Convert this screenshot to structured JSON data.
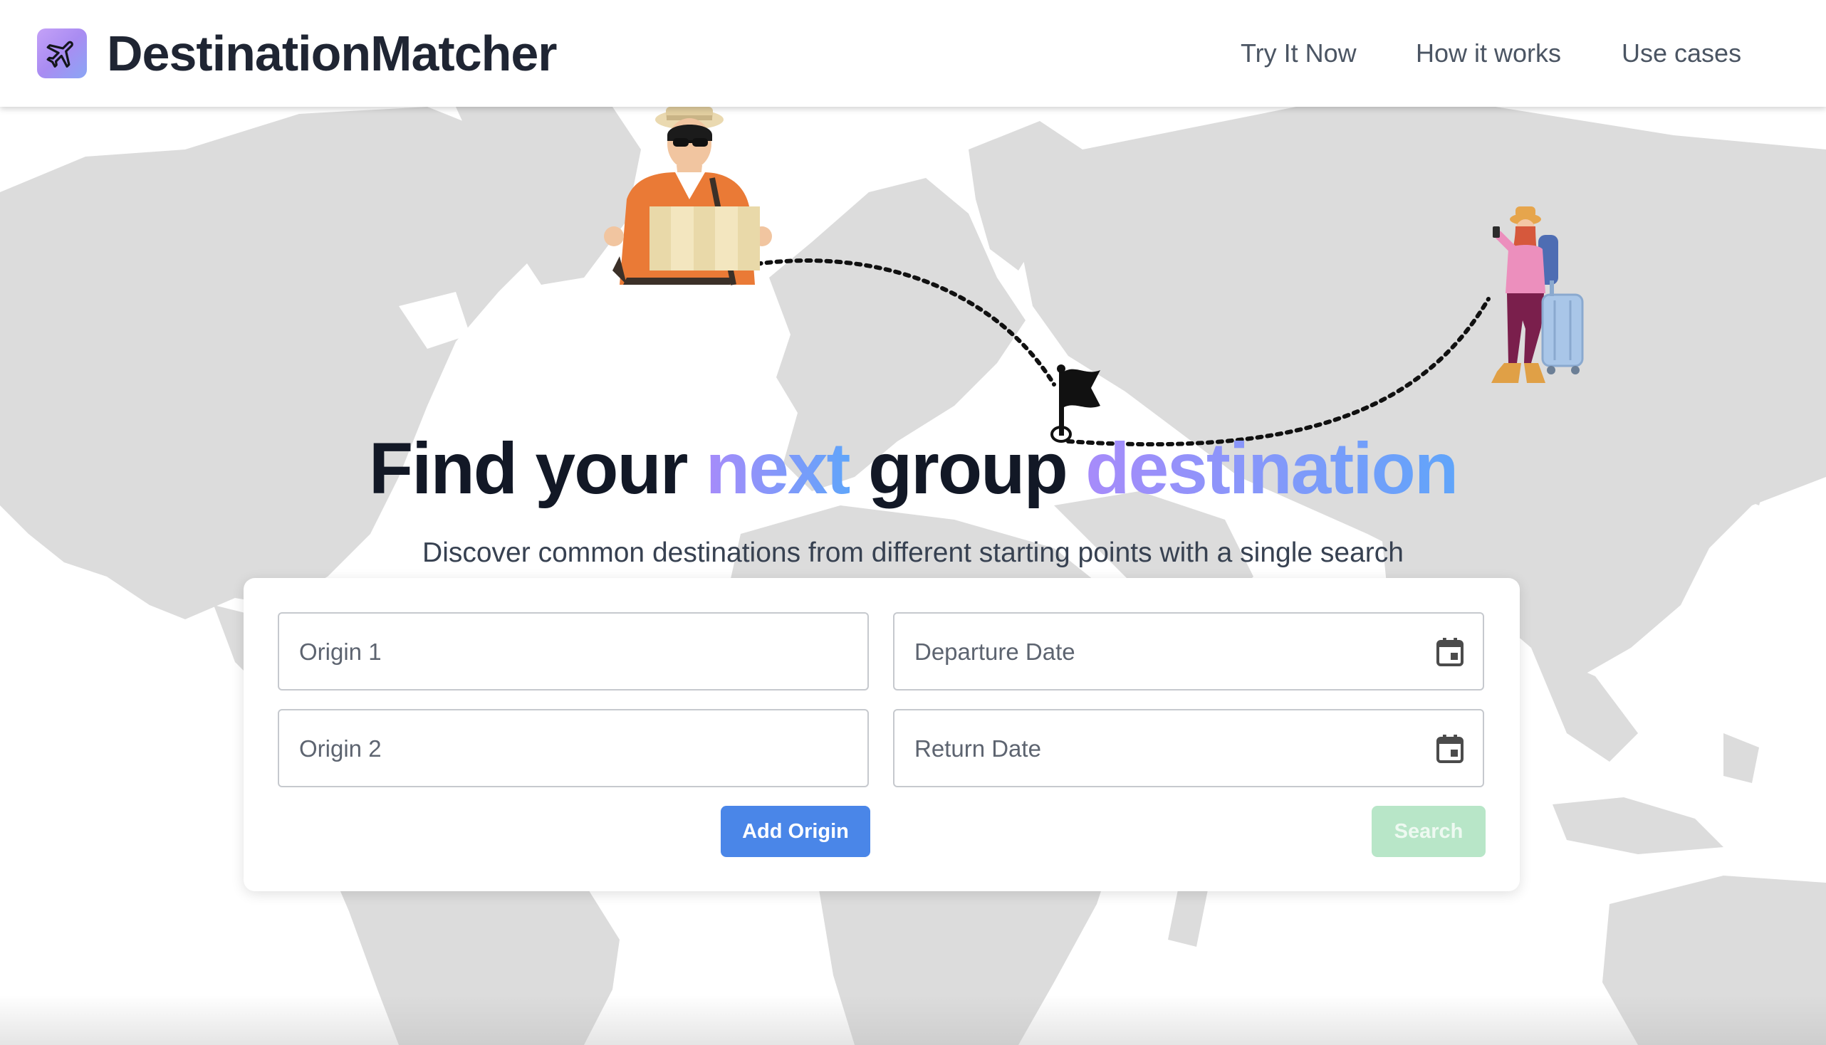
{
  "header": {
    "brand": "DestinationMatcher",
    "logo_icon": "airplane-icon",
    "nav": [
      {
        "label": "Try It Now"
      },
      {
        "label": "How it works"
      },
      {
        "label": "Use cases"
      }
    ]
  },
  "hero": {
    "title_parts": [
      "Find your ",
      "next",
      " group ",
      "destination"
    ],
    "subtitle": "Discover common destinations from different starting points with a single search",
    "illustrations": [
      "traveler-with-map",
      "traveler-with-suitcase",
      "destination-flag-icon"
    ]
  },
  "form": {
    "origin1_placeholder": "Origin 1",
    "origin2_placeholder": "Origin 2",
    "departure_placeholder": "Departure Date",
    "return_placeholder": "Return Date",
    "add_origin_label": "Add Origin",
    "search_label": "Search",
    "date_icon": "calendar-icon"
  },
  "colors": {
    "accent_gradient_start": "#a78bfa",
    "accent_gradient_end": "#60a5fa",
    "add_button": "#4a86e8",
    "search_button_disabled": "#b8e6c8",
    "map_land": "#dcdcdc"
  }
}
